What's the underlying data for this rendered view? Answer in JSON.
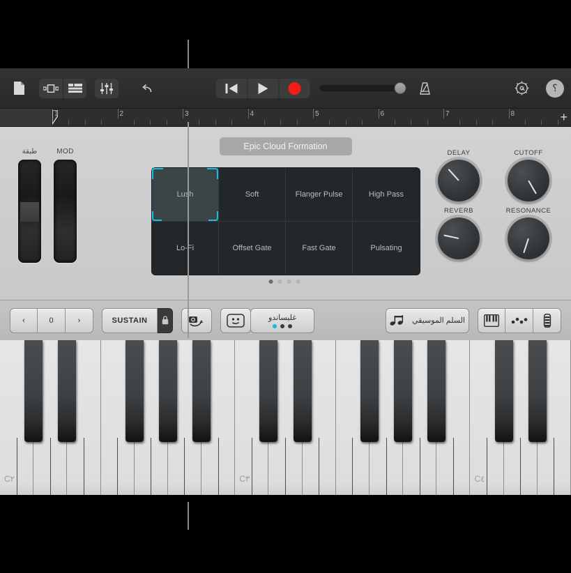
{
  "toolbar": {
    "doc_icon": "document-icon",
    "view_tracks_icon": "track-view-icon",
    "view_list_icon": "list-view-icon",
    "mixer_icon": "faders-icon",
    "undo_icon": "undo-icon",
    "rewind_icon": "rewind-icon",
    "play_icon": "play-icon",
    "record_icon": "record-icon",
    "metronome_icon": "metronome-icon",
    "settings_icon": "gear-icon",
    "help_label": "؟",
    "master_volume": 92
  },
  "ruler": {
    "bars": [
      "1",
      "2",
      "3",
      "4",
      "5",
      "6",
      "7",
      "8"
    ],
    "add_label": "+",
    "playhead_bar": "1"
  },
  "instrument": {
    "preset_title": "Epic Cloud Formation",
    "wheels": [
      {
        "label": "طبقة",
        "name": "pitch-bend-wheel",
        "value": 50
      },
      {
        "label": "MOD",
        "name": "modulation-wheel",
        "value": 0
      }
    ],
    "presets": [
      {
        "label": "Lush",
        "selected": true
      },
      {
        "label": "Soft",
        "selected": false
      },
      {
        "label": "Flanger Pulse",
        "selected": false
      },
      {
        "label": "High Pass",
        "selected": false
      },
      {
        "label": "Lo-Fi",
        "selected": false
      },
      {
        "label": "Offset Gate",
        "selected": false
      },
      {
        "label": "Fast Gate",
        "selected": false
      },
      {
        "label": "Pulsating",
        "selected": false
      }
    ],
    "page_dots": {
      "count": 4,
      "active": 0
    },
    "knobs": [
      {
        "label": "DELAY",
        "angle": -42
      },
      {
        "label": "CUTOFF",
        "angle": 150
      },
      {
        "label": "REVERB",
        "angle": -78
      },
      {
        "label": "RESONANCE",
        "angle": 198
      }
    ],
    "selection_color": "#15c1e0"
  },
  "controls": {
    "octave_prev": "‹",
    "octave_value": "0",
    "octave_next": "›",
    "sustain_label": "SUSTAIN",
    "lock_icon": "lock-icon",
    "arpeggiator_icon": "arpeggiator-icon",
    "expression_icon": "smiley-icon",
    "glissando_label": "غليساندو",
    "glissando_dots": {
      "count": 3,
      "active": 0
    },
    "scale_label": "السلم الموسيقي",
    "scale_icon": "eighth-notes-icon",
    "view_keyboard_icon": "keyboard-icon",
    "view_notes_icon": "notes-grid-icon",
    "view_strip_icon": "strip-icon"
  },
  "keyboard": {
    "octave_labels": [
      "C٢",
      "C٣",
      "C٤"
    ],
    "white_key_count": 17,
    "label_keys": [
      0,
      7,
      14
    ]
  }
}
